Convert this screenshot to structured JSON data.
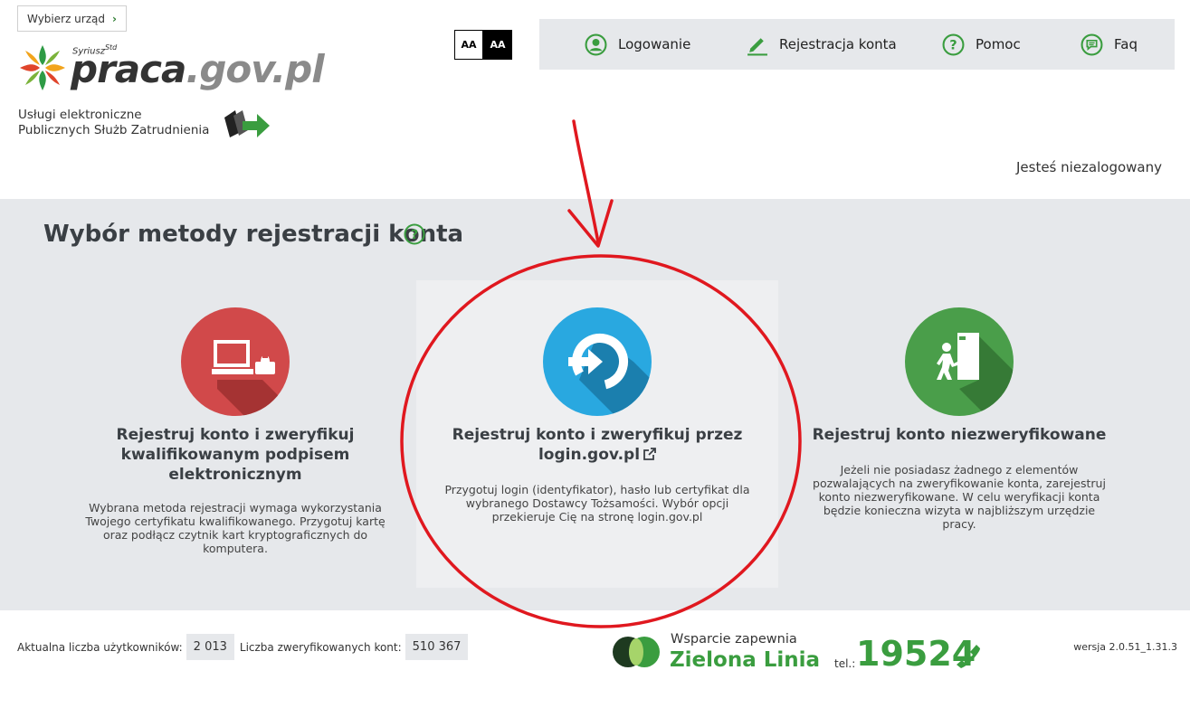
{
  "header": {
    "urzad_button": "Wybierz urząd",
    "logo": {
      "super": "Syriusz",
      "super_sup": "Std",
      "part1": "praca",
      "part2": ".gov.pl"
    },
    "uslugi_line1": "Usługi elektroniczne",
    "uslugi_line2": "Publicznych Służb Zatrudnienia",
    "font_normal": "AA",
    "font_contrast": "AA",
    "nav": {
      "login": "Logowanie",
      "register": "Rejestracja konta",
      "help": "Pomoc",
      "faq": "Faq"
    },
    "status": "Jesteś niezalogowany"
  },
  "main": {
    "title": "Wybór metody rejestracji konta",
    "options": [
      {
        "title": "Rejestruj konto i zweryfikuj kwalifikowanym podpisem elektronicznym",
        "desc": "Wybrana metoda rejestracji wymaga wykorzystania Twojego certyfikatu kwalifikowanego. Przygotuj kartę oraz podłącz czytnik kart kryptograficznych do komputera.",
        "icon": "computer-card-reader-icon",
        "color": "#d1494a"
      },
      {
        "title": "Rejestruj konto i zweryfikuj przez login.gov.pl",
        "desc": "Przygotuj login (identyfikator), hasło lub certyfikat dla wybranego Dostawcy Tożsamości. Wybór opcji przekieruje Cię na stronę login.gov.pl",
        "icon": "login-arrow-icon",
        "color": "#29a8e0"
      },
      {
        "title": "Rejestruj konto niezweryfikowane",
        "desc": "Jeżeli nie posiadasz żadnego z elementów pozwalających na zweryfikowanie konta, zarejestruj konto niezweryfikowane. W celu weryfikacji konta będzie konieczna wizyta w najbliższym urzędzie pracy.",
        "icon": "person-door-icon",
        "color": "#4a9e4a"
      }
    ]
  },
  "footer": {
    "users_label": "Aktualna liczba użytkowników:",
    "users_value": "2 013",
    "verified_label": "Liczba zweryfikowanych kont:",
    "verified_value": "510 367",
    "support_small": "Wsparcie zapewnia",
    "support_big": "Zielona Linia",
    "tel_label": "tel.:",
    "tel_number": "19524",
    "version": "wersja 2.0.51_1.31.3"
  },
  "colors": {
    "accent_green": "#3a9d3f",
    "band_bg": "#e6e8eb",
    "annotation_red": "#e0181f"
  }
}
